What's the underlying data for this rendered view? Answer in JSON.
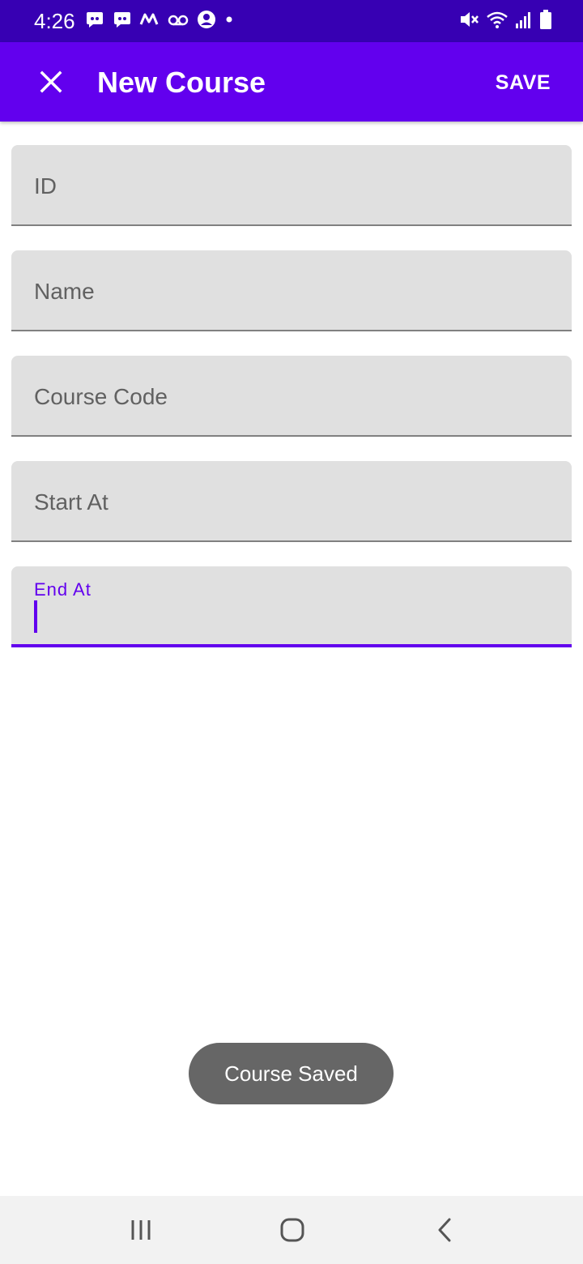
{
  "status_bar": {
    "time": "4:26",
    "left_icons": [
      "discord-icon",
      "discord-icon",
      "app-icon",
      "voicemail-icon",
      "account-icon",
      "dot-icon"
    ],
    "right_icons": [
      "mute-icon",
      "wifi-icon",
      "signal-icon",
      "battery-icon"
    ]
  },
  "app_bar": {
    "title": "New Course",
    "save_label": "SAVE",
    "close_icon": "close-icon"
  },
  "form": {
    "fields": [
      {
        "label": "ID",
        "value": ""
      },
      {
        "label": "Name",
        "value": ""
      },
      {
        "label": "Course Code",
        "value": ""
      },
      {
        "label": "Start At",
        "value": ""
      },
      {
        "label": "End At",
        "value": ""
      }
    ]
  },
  "toast": {
    "message": "Course Saved"
  },
  "nav_bar": {
    "icons": [
      "recents-icon",
      "home-icon",
      "back-icon"
    ]
  },
  "colors": {
    "status_bar": "#3700b3",
    "primary": "#6200ee",
    "field_background": "#e0e0e0",
    "field_underline": "#808080",
    "label_text": "#616161",
    "toast_background": "#666666",
    "nav_bar_background": "#f2f2f2"
  }
}
